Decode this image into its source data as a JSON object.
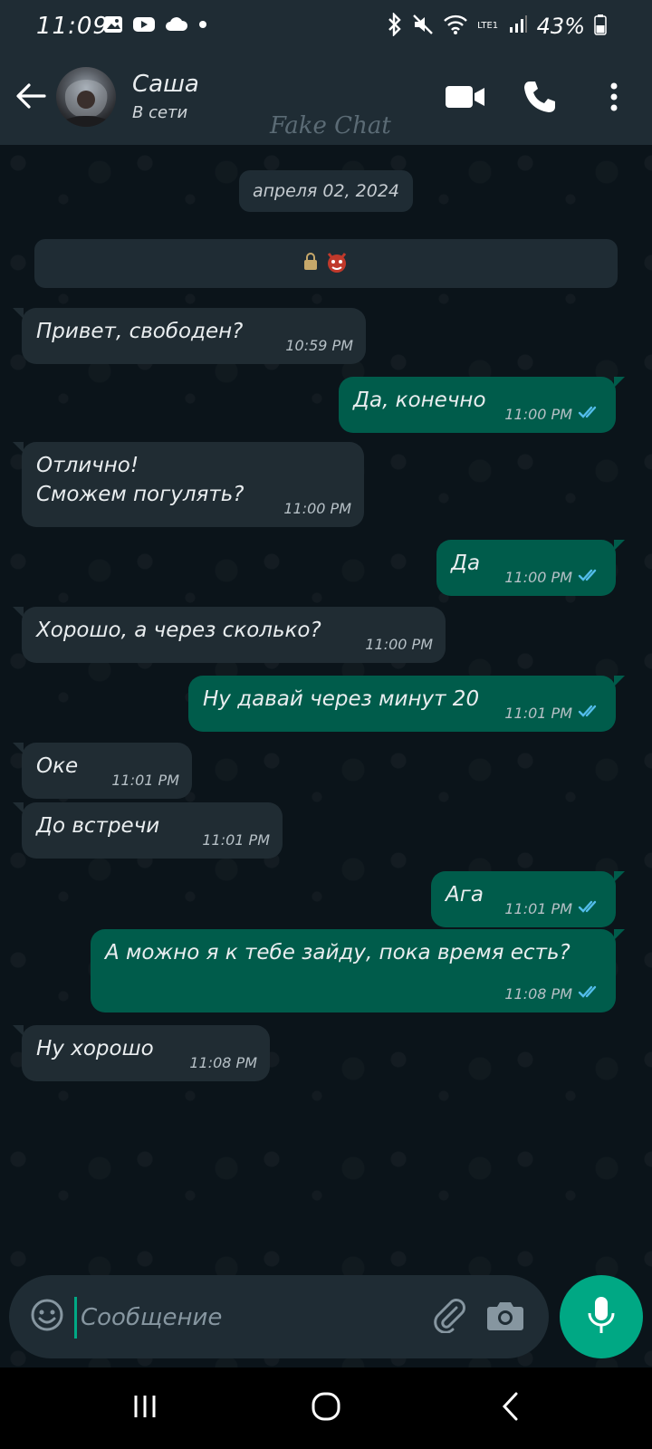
{
  "status_bar": {
    "time": "11:09",
    "battery": "43%",
    "icons": [
      "gallery-icon",
      "youtube-icon",
      "cloud-icon",
      "dot-icon",
      "bluetooth-icon",
      "mute-icon",
      "wifi-icon",
      "lte-icon",
      "signal-icon",
      "battery-icon"
    ],
    "lte_label": "LTE1"
  },
  "header": {
    "contact_name": "Саша",
    "contact_status": "В сети",
    "watermark": "Fake Chat",
    "icons": [
      "back-arrow-icon",
      "video-call-icon",
      "phone-icon",
      "more-options-icon"
    ]
  },
  "chat": {
    "date": "апреля 02, 2024",
    "encryption_icons": [
      "lock-icon",
      "emoji-devil-icon"
    ],
    "messages": [
      {
        "direction": "in",
        "text": "Привет, свободен?",
        "time": "10:59 PM"
      },
      {
        "direction": "out",
        "text": "Да, конечно",
        "time": "11:00 PM",
        "status": "read"
      },
      {
        "direction": "in",
        "text": "Отлично!\nСможем погулять?",
        "time": "11:00 PM"
      },
      {
        "direction": "out",
        "text": "Да",
        "time": "11:00 PM",
        "status": "read"
      },
      {
        "direction": "in",
        "text": "Хорошо,  а через сколько?",
        "time": "11:00 PM"
      },
      {
        "direction": "out",
        "text": "Ну давай через минут 20",
        "time": "11:01 PM",
        "status": "read"
      },
      {
        "direction": "in",
        "text": "Оке",
        "time": "11:01 PM"
      },
      {
        "direction": "in",
        "text": "До встречи",
        "time": "11:01 PM"
      },
      {
        "direction": "out",
        "text": "Ага",
        "time": "11:01 PM",
        "status": "read"
      },
      {
        "direction": "out",
        "text": "А можно я к тебе зайду, пока время есть?",
        "time": "11:08 PM",
        "status": "read"
      },
      {
        "direction": "in",
        "text": "Ну хорошо",
        "time": "11:08 PM"
      }
    ]
  },
  "composer": {
    "placeholder": "Сообщение",
    "value": "",
    "icons": [
      "emoji-icon",
      "attach-icon",
      "camera-icon",
      "microphone-icon"
    ]
  },
  "nav_bar": {
    "icons": [
      "recent-apps-icon",
      "home-icon",
      "back-icon"
    ]
  },
  "colors": {
    "chat_background": "#0b141a",
    "header_background": "#1f2c34",
    "incoming_bubble": "#202c33",
    "outgoing_bubble": "#005c4b",
    "accent": "#00a884",
    "read_tick": "#53bdeb"
  }
}
